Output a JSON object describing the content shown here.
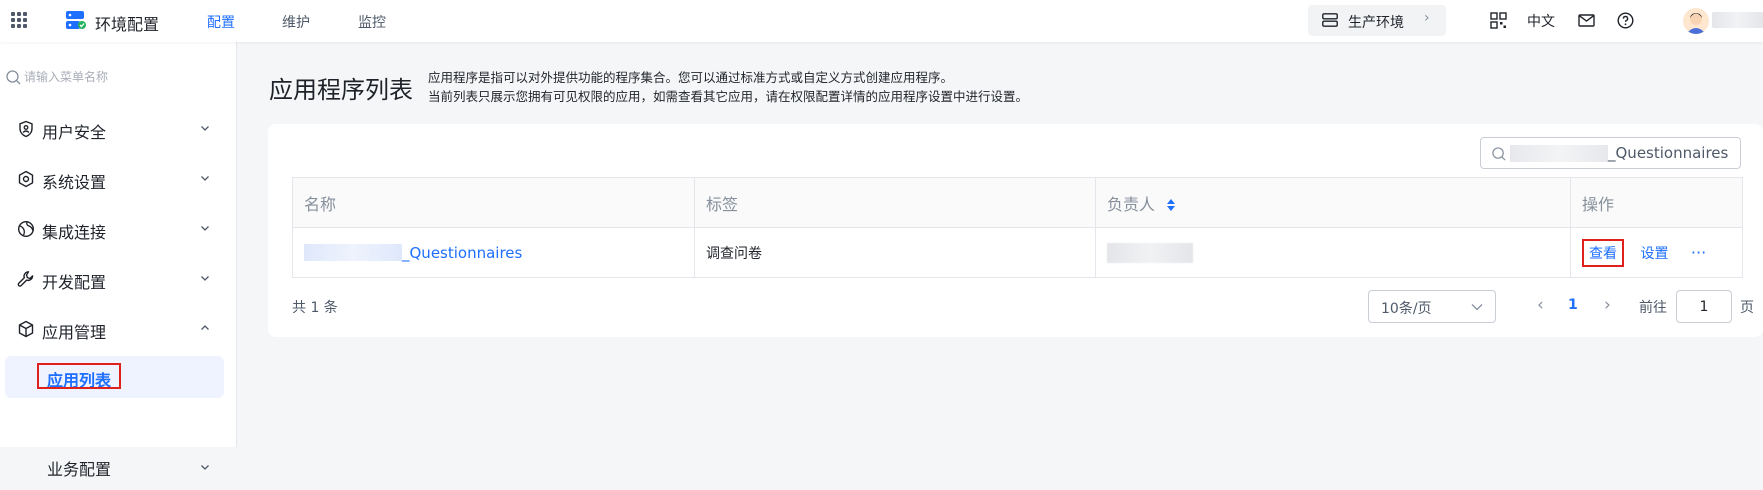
{
  "header": {
    "app_title": "环境配置",
    "nav_tabs": [
      {
        "label": "配置",
        "active": true
      },
      {
        "label": "维护",
        "active": false
      },
      {
        "label": "监控",
        "active": false
      }
    ],
    "environment": "生产环境",
    "language": "中文",
    "brand_color": "#1e6fff"
  },
  "sidebar": {
    "search_placeholder": "请输入菜单名称",
    "menu": [
      {
        "label": "用户安全",
        "icon": "shield-icon",
        "expanded": false
      },
      {
        "label": "系统设置",
        "icon": "gear-icon",
        "expanded": false
      },
      {
        "label": "集成连接",
        "icon": "globe-icon",
        "expanded": false
      },
      {
        "label": "开发配置",
        "icon": "wrench-icon",
        "expanded": false
      },
      {
        "label": "应用管理",
        "icon": "cube-icon",
        "expanded": true
      }
    ],
    "sub_items": [
      {
        "label": "应用列表",
        "active": true
      },
      {
        "label": "业务配置",
        "active": false
      }
    ]
  },
  "main": {
    "title": "应用程序列表",
    "description_line1": "应用程序是指可以对外提供功能的程序集合。您可以通过标准方式或自定义方式创建应用程序。",
    "description_line2": "当前列表只展示您拥有可见权限的应用，如需查看其它应用，请在权限配置详情的应用程序设置中进行设置。",
    "search_value_suffix": "_Questionnaires",
    "table": {
      "columns": [
        "名称",
        "标签",
        "负责人",
        "操作"
      ],
      "rows": [
        {
          "name_suffix": "_Questionnaires",
          "tag": "调查问卷",
          "owner": "",
          "actions": {
            "view": "查看",
            "settings": "设置",
            "more": "···"
          }
        }
      ]
    },
    "pagination": {
      "total_label": "共 1 条",
      "page_size": "10条/页",
      "prev": "‹",
      "current_page": "1",
      "next": "›",
      "goto_label": "前往",
      "goto_value": "1",
      "page_unit": "页"
    }
  }
}
